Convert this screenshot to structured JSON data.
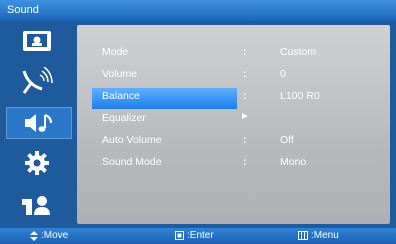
{
  "window": {
    "title": "Sound"
  },
  "sidebar": {
    "items": [
      {
        "icon": "picture-icon"
      },
      {
        "icon": "channel-antenna-icon"
      },
      {
        "icon": "sound-icon",
        "active": true
      },
      {
        "icon": "setup-gear-icon"
      },
      {
        "icon": "input-icon"
      }
    ]
  },
  "menu": {
    "rows": [
      {
        "label": "Mode",
        "separator": ":",
        "value": "Custom"
      },
      {
        "label": "Volume",
        "separator": ":",
        "value": "0"
      },
      {
        "label": "Balance",
        "separator": ":",
        "value": "L100  R0"
      },
      {
        "label": "Equalizer",
        "separator": "►",
        "value": ""
      },
      {
        "label": "Auto Volume",
        "separator": ":",
        "value": "Off"
      },
      {
        "label": "Sound Mode",
        "separator": ":",
        "value": "Mono"
      }
    ],
    "selected_index": 2
  },
  "footer": {
    "move_label": ":Move",
    "enter_label": ":Enter",
    "menu_label": ":Menu"
  },
  "colors": {
    "accent": "#1e5a9c",
    "highlight": "#3a9bf5",
    "panel": "#bfc1c4"
  }
}
